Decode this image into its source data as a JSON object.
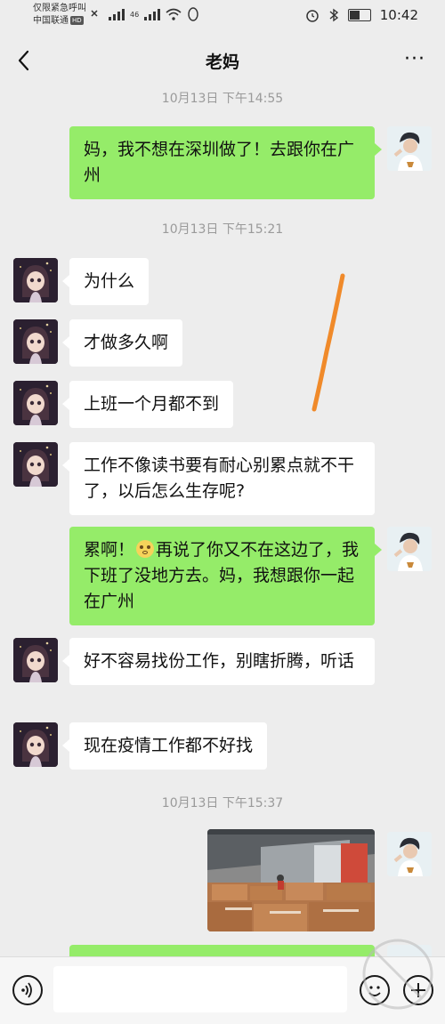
{
  "status_bar": {
    "line1": "仅限紧急呼叫",
    "line2": "中国联通",
    "hd": "HD",
    "network": "46",
    "time": "10:42",
    "battery_level": 0.5
  },
  "header": {
    "title": "老妈",
    "back_icon": "chevron-left-icon",
    "more_label": "···"
  },
  "chat": {
    "timestamps": [
      "10月13日 下午14:55",
      "10月13日 下午15:21",
      "10月13日 下午15:37"
    ],
    "messages": [
      {
        "from": "self",
        "text": "妈，我不想在深圳做了！去跟你在广州"
      },
      {
        "from": "mom",
        "text": "为什么"
      },
      {
        "from": "mom",
        "text": "才做多久啊"
      },
      {
        "from": "mom",
        "text": "上班一个月都不到"
      },
      {
        "from": "mom",
        "text": "工作不像读书要有耐心别累点就不干了，以后怎么生存呢?"
      },
      {
        "from": "self",
        "text_before_emoji": "累啊！",
        "emoji": "flushed-face-emoji",
        "text_after_emoji": "再说了你又不在这边了，我下班了没地方去。妈，我想跟你一起在广州"
      },
      {
        "from": "mom",
        "text": "好不容易找份工作，别瞎折腾，听话"
      },
      {
        "from": "mom",
        "text": "现在疫情工作都不好找"
      },
      {
        "from": "self",
        "type": "image",
        "description": "warehouse-boxes-photo"
      }
    ]
  },
  "input_bar": {
    "voice_icon": "voice-icon",
    "emoji_icon": "emoji-icon",
    "plus_icon": "plus-icon"
  },
  "colors": {
    "background": "#ededed",
    "self_bubble": "#95ec69",
    "other_bubble": "#ffffff",
    "timestamp": "#9a9a9a",
    "annotation_stroke": "#f08a2a"
  }
}
